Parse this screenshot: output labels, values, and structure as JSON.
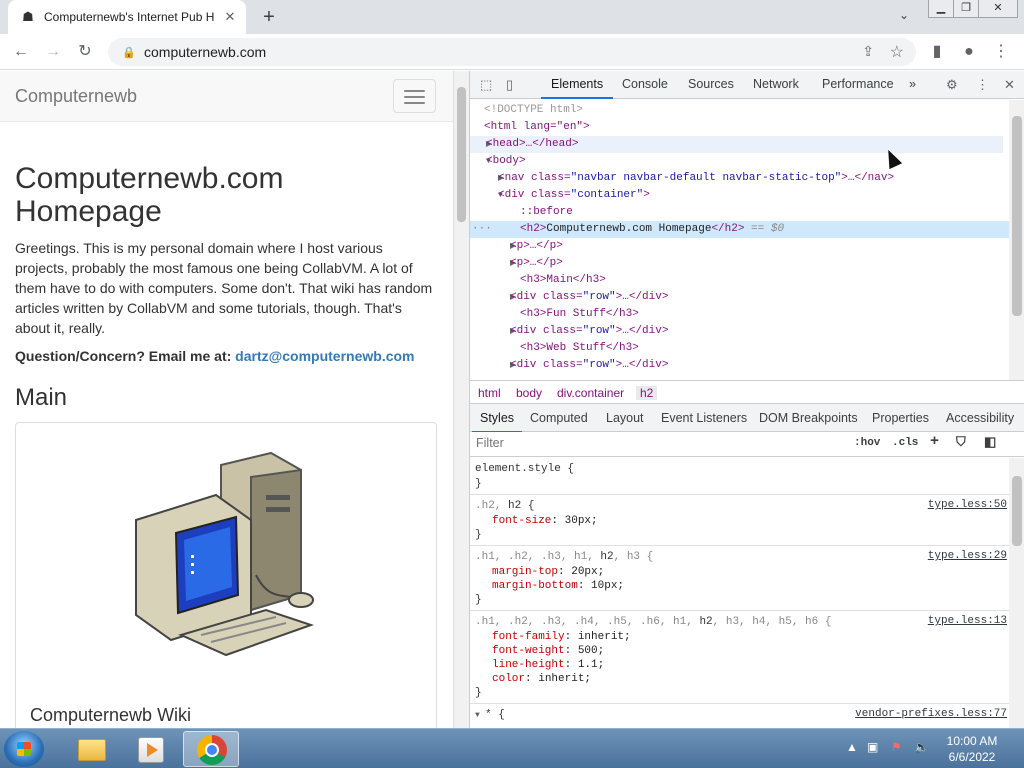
{
  "browser": {
    "tab_title": "Computernewb's Internet Pub H",
    "url": "computernewb.com"
  },
  "page": {
    "brand": "Computernewb",
    "heading_line1": "Computernewb.com",
    "heading_line2": "Homepage",
    "intro": "Greetings. This is my personal domain where I host various projects, probably the most famous one being CollabVM. A lot of them have to do with computers. Some don't. That wiki has random articles written by CollabVM and some tutorials, though. That's about it, really.",
    "question_label": "Question/Concern? Email me at:",
    "email": "dartz@computernewb.com",
    "main_heading": "Main",
    "card_caption": "Computernewb Wiki"
  },
  "devtools": {
    "tabs": [
      "Elements",
      "Console",
      "Sources",
      "Network",
      "Performance"
    ],
    "more": "»",
    "dom": {
      "doctype": "<!DOCTYPE html>",
      "html_open": "<html lang=\"en\">",
      "head": "<head>…</head>",
      "body": "<body>",
      "nav_open": "<nav class=",
      "nav_class": "\"navbar navbar-default navbar-static-top\"",
      "nav_close": ">…</nav>",
      "div_open": "<div class=",
      "div_class": "\"container\"",
      "gt": ">",
      "before": "::before",
      "h2_open": "<h2>",
      "h2_text": "Computernewb.com Homepage",
      "h2_close": "</h2>",
      "eq": " == $0",
      "p": "<p>…</p>",
      "h3_main": "<h3>Main</h3>",
      "div_row": "\"row\"",
      "div_row_close": ">…</div>",
      "h3_fun": "<h3>Fun Stuff</h3>",
      "h3_web": "<h3>Web Stuff</h3>"
    },
    "breadcrumbs": [
      "html",
      "body",
      "div.container",
      "h2"
    ],
    "sub_tabs": [
      "Styles",
      "Computed",
      "Layout",
      "Event Listeners",
      "DOM Breakpoints",
      "Properties",
      "Accessibility"
    ],
    "filter_placeholder": "Filter",
    "hov": ":hov",
    "cls": ".cls",
    "rules": {
      "r0_sel": "element.style {",
      "r1_sel_dim": ".h2, ",
      "r1_sel": "h2 {",
      "r1_src": "type.less:50",
      "r1_p1": "font-size",
      "r1_v1": ": 30px;",
      "r2_sel_dim": ".h1, .h2, .h3, h1, ",
      "r2_sel": "h2",
      "r2_sel_end": ", h3 {",
      "r2_src": "type.less:29",
      "r2_p1": "margin-top",
      "r2_v1": ": 20px;",
      "r2_p2": "margin-bottom",
      "r2_v2": ": 10px;",
      "r3_sel_dim": ".h1, .h2, .h3, .h4, .h5, .h6, h1, ",
      "r3_sel": "h2",
      "r3_sel_end": ", h3, h4, h5, h6 {",
      "r3_src": "type.less:13",
      "r3_p1": "font-family",
      "r3_v1": ": inherit;",
      "r3_p2": "font-weight",
      "r3_v2": ": 500;",
      "r3_p3": "line-height",
      "r3_v3": ": 1.1;",
      "r3_p4": "color",
      "r3_v4": ": inherit;",
      "r4_sel": "* {",
      "r4_src": "vendor-prefixes.less:77",
      "close": "}"
    }
  },
  "taskbar": {
    "time": "10:00 AM",
    "date": "6/6/2022"
  }
}
